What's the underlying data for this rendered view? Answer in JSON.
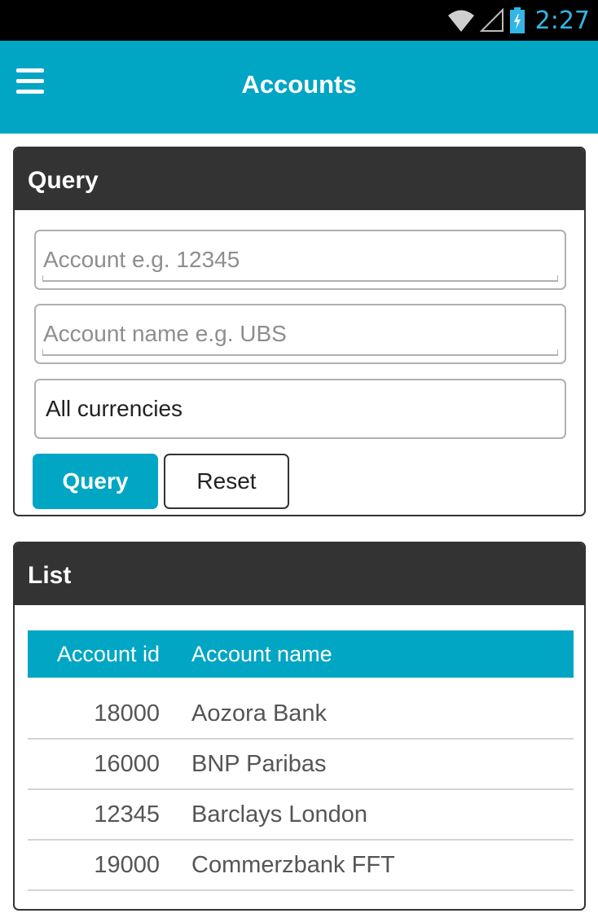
{
  "status_bar": {
    "time": "2:27",
    "icons": [
      "wifi-icon",
      "signal-icon",
      "battery-charging-icon"
    ],
    "time_color": "#33b5e5"
  },
  "app_bar": {
    "title": "Accounts",
    "menu_icon": "hamburger-menu-icon",
    "color": "#00a6c4"
  },
  "query_panel": {
    "title": "Query",
    "account_placeholder": "Account e.g. 12345",
    "account_value": "",
    "account_name_placeholder": "Account name e.g. UBS",
    "account_name_value": "",
    "currency_selected": "All currencies",
    "query_label": "Query",
    "reset_label": "Reset"
  },
  "list_panel": {
    "title": "List",
    "columns": [
      "Account id",
      "Account name"
    ],
    "rows": [
      {
        "id": "18000",
        "name": "Aozora Bank"
      },
      {
        "id": "16000",
        "name": "BNP Paribas"
      },
      {
        "id": "12345",
        "name": "Barclays London"
      },
      {
        "id": "19000",
        "name": "Commerzbank FFT"
      }
    ]
  },
  "colors": {
    "accent": "#00a6c4",
    "panel_header": "#333333"
  }
}
